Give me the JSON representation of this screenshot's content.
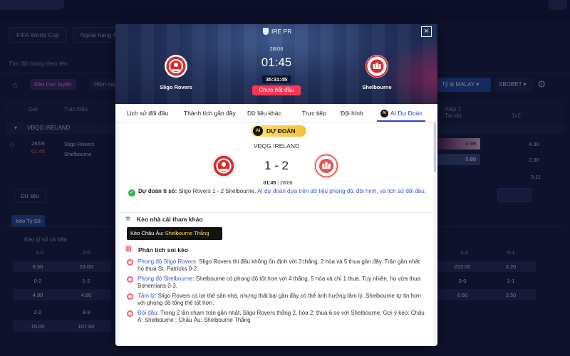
{
  "background": {
    "tabs": [
      "FIFA World Cup",
      "Ngoại hạng An"
    ],
    "search_placeholder": "Tìm đội bóng theo tên",
    "live_label": "Kèo trực tuyến",
    "today_label": "Hôm nay",
    "odds_type": "Tỷ lệ MALAY",
    "bookmaker": "SBOBET",
    "table_headers": {
      "time": "Giờ",
      "match": "Trận Đấu",
      "half1": "Hiệp 1",
      "ou": "Tài xỉu",
      "x12": "1x2"
    },
    "league": "VĐQG IRELAND",
    "match": {
      "date": "28/06",
      "time": "01:45",
      "home": "Sligo Rovers",
      "away": "Shelbourne"
    },
    "odds_cells": [
      "0.98",
      "0.88",
      "4.30",
      "2.30",
      "3.11"
    ],
    "data_button": "Dữ liệu",
    "score_tab": "Kèo Tỷ Số",
    "score_title": "Kèo tỷ số cả trận",
    "score_headers": [
      "1-0",
      "2-0",
      "4-3",
      "0-1"
    ],
    "score_rows": [
      [
        "8.50",
        "23.00",
        "222.00",
        "3.20"
      ],
      [
        "0-2",
        "1-2",
        "0-0",
        "1-1"
      ],
      [
        "4.90",
        "4.80",
        "6.60",
        "3.50"
      ],
      [
        "2-2",
        "3-3"
      ],
      [
        "15.00",
        "107.00"
      ]
    ]
  },
  "modal": {
    "league_code": "IRE PR",
    "date": "28/06",
    "time": "01:45",
    "countdown": "35:31:45",
    "status": "Chưa bắt đầu",
    "home_team": "Sligo Rovers",
    "away_team": "Shelbourne",
    "close_icon": "×",
    "tabs": [
      "Lịch sử đối đầu",
      "Thành tích gần đây",
      "Dữ liệu khác",
      "Trực tiếp",
      "Đội hình",
      "AI Dự Đoán"
    ],
    "ai_badge": "AI",
    "prediction_label": "DỰ ĐOÁN",
    "league_name": "VĐQG IRELAND",
    "score": "1 - 2",
    "kickoff_time": "01:45",
    "kickoff_date": "28/06",
    "verdict_label": "Dự đoán tỉ số:",
    "verdict_text": "Sligo Rovers 1 - 2 Shelbourne.",
    "verdict_note": "AI dự đoán dựa trên dữ liệu phong độ, đội hình, và lịch sử đối đầu.",
    "bookmaker_title": "Kèo nhà cái tham khảo",
    "chip_label": "Kèo Châu Âu:",
    "chip_value": "Shelbourne Thắng",
    "analysis_title": "Phân tích soi kèo",
    "analysis": [
      {
        "label": "Phong độ Sligo Rovers:",
        "text": "Sligo Rovers thi đấu không ổn định với 3 thắng, 2 hòa và 5 thua gần đây. Trận gần nhất họ thua St. Patricks 0-2."
      },
      {
        "label": "Phong độ Shelbourne:",
        "text": "Shelbourne có phong độ tốt hơn với 4 thắng, 5 hòa và chỉ 1 thua. Tuy nhiên, họ vừa thua Bohemians 0-3."
      },
      {
        "label": "Tâm lý:",
        "text": "Sligo Rovers có lợi thế sân nhà, nhưng thất bại gần đây có thể ảnh hưởng tâm lý. Shelbourne tự tin hơn với phong độ tổng thể tốt hơn."
      },
      {
        "label": "Đối đầu:",
        "text": "Trong 2 lần chạm trán gần nhất, Sligo Rovers thắng 2, hòa 2, thua 6 so với Shelbourne. Gợi ý kèo: Châu Á: Shelbourne ; Châu Âu: Shelbourne Thắng"
      }
    ]
  },
  "icons": {
    "star": "star-icon",
    "gear": "gear-icon",
    "check": "check-circle-icon",
    "chart": "analysis-chart-icon"
  },
  "colors": {
    "accent_blue": "#2b47c4",
    "status_red": "#ff3556",
    "ai_yellow": "#f4c232",
    "check_green": "#2db84c"
  }
}
